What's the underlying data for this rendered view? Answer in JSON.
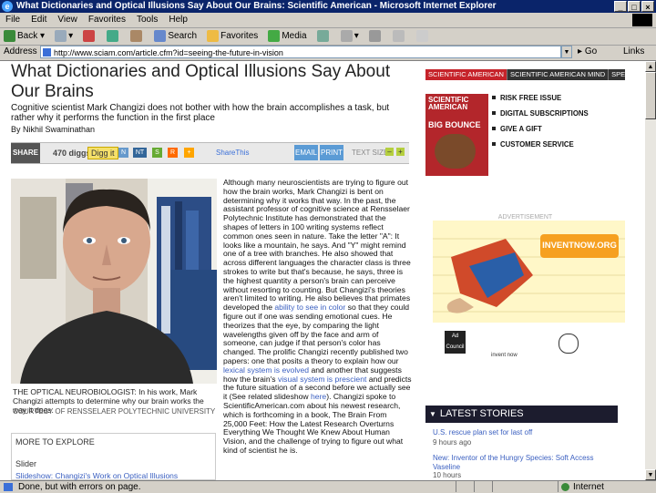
{
  "window": {
    "title": "What Dictionaries and Optical Illusions Say About Our Brains: Scientific American - Microsoft Internet Explorer",
    "menu": [
      "File",
      "Edit",
      "View",
      "Favorites",
      "Tools",
      "Help"
    ],
    "toolbar": {
      "back": "Back",
      "search": "Search",
      "favorites": "Favorites",
      "media": "Media"
    },
    "address_label": "Address",
    "url": "http://www.sciam.com/article.cfm?id=seeing-the-future-in-vision",
    "go": "Go",
    "links": "Links"
  },
  "status": {
    "text": "Done, but with errors on page.",
    "zone": "Internet"
  },
  "article": {
    "title": "What Dictionaries and Optical Illusions Say About Our Brains",
    "dek": "Cognitive scientist Mark Changizi does not bother with how the brain accomplishes a task, but rather why it performs the function in the first place",
    "byline": "By Nikhil Swaminathan",
    "share": {
      "label": "SHARE",
      "diggs": "470 diggs",
      "digg_it": "Digg it",
      "icons": [
        "N",
        "NT",
        "S",
        "R",
        "+"
      ],
      "share_this": "ShareThis",
      "email": "EMAIL",
      "print": "PRINT",
      "text_size": "TEXT SIZE:",
      "minus": "–",
      "plus": "+"
    },
    "photo_caption": "THE OPTICAL NEUROBIOLOGIST: In his work, Mark Changizi attempts to determine why our brain works the way it does.",
    "photo_credit": "COURTESY OF RENSSELAER POLYTECHNIC UNIVERSITY",
    "more": {
      "title": "MORE TO EXPLORE",
      "slider": "Slider",
      "link": "Slideshow: Changizi's Work on Optical Illusions"
    },
    "body": [
      "Although many neuroscientists are trying to figure out how the brain works, Mark Changizi is bent on determining why it works that way. In the past, the assistant professor of cognitive science at Rensselaer Polytechnic Institute has demonstrated that the shapes of letters in 100 writing systems reflect common ones seen in nature. Take the letter \"A\": It looks like a mountain, he says. And \"Y\" might remind one of a tree with branches. He also showed that across different languages the character class is three strokes to write but that's because, he says, three is the highest quantity a person's brain can perceive without resorting to counting. But Changizi's theories aren't limited to writing. He also believes that primates developed the",
      "ability to see in color",
      "so that they could figure out if one was sending emotional cues. He theorizes that the eye, by comparing the light wavelengths given off by the face and arm of someone, can judge if that person's color has changed. The prolific Changizi recently published two papers: one that posits a theory to explain how our",
      "lexical system is evolved",
      "and another that suggests how the brain's",
      "visual system is prescient",
      "and predicts the future situation of a second before we actually see it (See related slideshow",
      "here",
      "). Changizi spoke to ScientificAmerican.com about his newest research, which is forthcoming in a book, The Brain From 25,000 Feet: How the Latest Research Overturns Everything We Thought We Knew About Human Vision, and the challenge of trying to figure out what kind of scientist he is."
    ]
  },
  "sidebar": {
    "tabs": [
      "SCIENTIFIC AMERICAN",
      "SCIENTIFIC AMERICAN MIND",
      "SPECIAL OFFER"
    ],
    "cover": {
      "logo": "SCIENTIFIC AMERICAN",
      "headline": "BIG BOUNCE"
    },
    "links": [
      "RISK FREE ISSUE",
      "DIGITAL SUBSCRIPTIONS",
      "GIVE A GIFT",
      "CUSTOMER SERVICE"
    ],
    "ad_label": "ADVERTISEMENT",
    "ad": {
      "url": "INVENTNOW.ORG",
      "logo1": "Ad Council",
      "logo2": "invent now"
    },
    "latest_title": "LATEST STORIES",
    "news": [
      {
        "title": "U.S. rescue plan set for last off",
        "meta": "9 hours ago"
      },
      {
        "title": "New: Inventor of the Hungry Species: Soft Access Vaseline",
        "meta": "10 hours"
      }
    ]
  },
  "colors": {
    "accent": "#c6232a",
    "link": "#3a5fc0",
    "titlebar": "#0a246a"
  }
}
